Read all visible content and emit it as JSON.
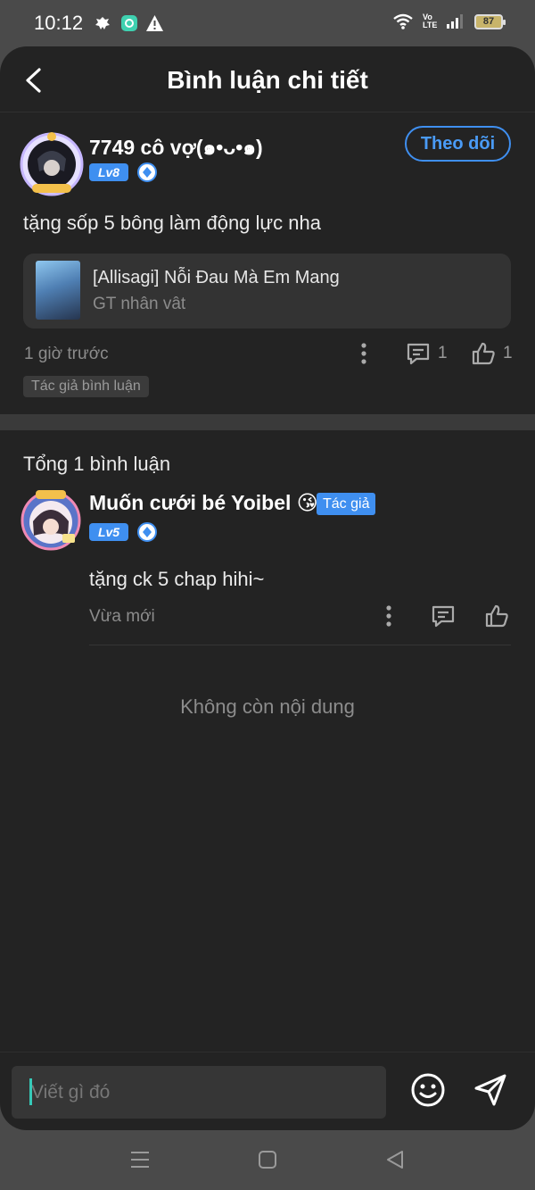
{
  "status_bar": {
    "time": "10:12",
    "network_label": "Vo LTE",
    "battery": "87",
    "icons": [
      "bug-icon",
      "app-notification-icon",
      "warning-icon",
      "wifi-icon",
      "signal-icon",
      "battery-icon"
    ]
  },
  "header": {
    "title": "Bình luận chi tiết",
    "back_icon": "chevron-left-icon"
  },
  "main_comment": {
    "user_name": "7749 cô vợ(๑•ᴗ•๑)",
    "level": "Lv8",
    "follow_label": "Theo dõi",
    "text": "tặng sốp 5 bông làm động lực nha",
    "book": {
      "title": "[Allisagi] Nỗi Đau Mà Em Mang",
      "subtitle": "GT nhân vât"
    },
    "time_ago": "1 giờ trước",
    "reply_count": "1",
    "like_count": "1",
    "tag": "Tác giả bình luận"
  },
  "replies_section": {
    "title": "Tổng 1 bình luận",
    "replies": [
      {
        "user_name": "Muốn cưới bé Yoibel 😘",
        "badge": "Tác giả",
        "level": "Lv5",
        "text": "tặng ck 5 chap hihi~",
        "time_ago": "Vừa mới"
      }
    ],
    "empty_text": "Không còn nội dung"
  },
  "composer": {
    "placeholder": "Viết gì đó",
    "emoji_icon": "smiley-icon",
    "send_icon": "send-icon"
  },
  "colors": {
    "accent": "#3f8ff0",
    "background": "#232323",
    "muted_text": "#8c8c8c"
  }
}
